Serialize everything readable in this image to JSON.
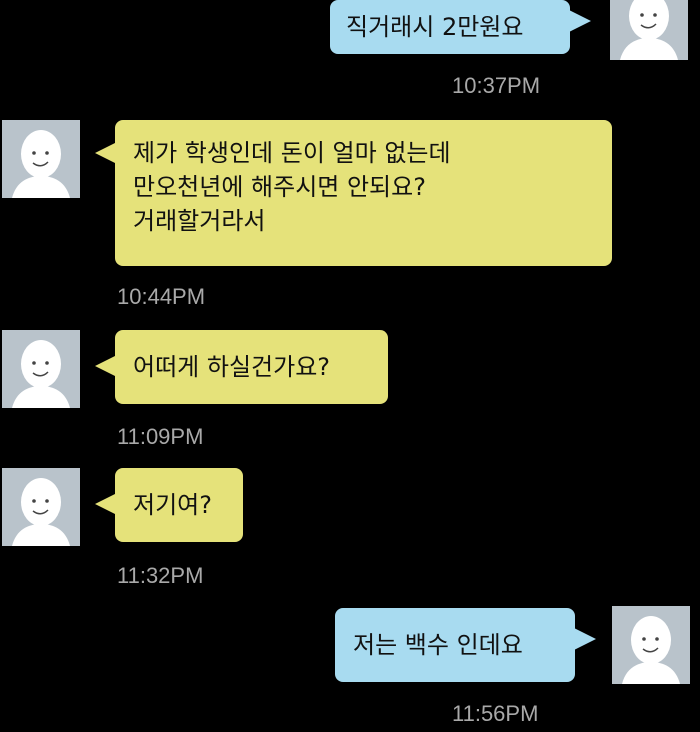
{
  "messages": [
    {
      "side": "sent",
      "text": "직거래시 2만원요",
      "time": "10:37PM"
    },
    {
      "side": "received",
      "text": "제가 학생인데 돈이 얼마 없는데\n만오천년에 해주시면 안되요?\n거래할거라서",
      "time": "10:44PM"
    },
    {
      "side": "received",
      "text": "어떠게 하실건가요?",
      "time": "11:09PM"
    },
    {
      "side": "received",
      "text": "저기여?",
      "time": "11:32PM"
    },
    {
      "side": "sent",
      "text": "저는 백수 인데요",
      "time": "11:56PM"
    }
  ],
  "avatar_icon": "default-profile-icon",
  "colors": {
    "background": "#000000",
    "received_bubble": "#e5e27a",
    "sent_bubble": "#a8dbf0",
    "avatar_bg": "#b9c3cb",
    "timestamp": "#a9a9a9"
  }
}
